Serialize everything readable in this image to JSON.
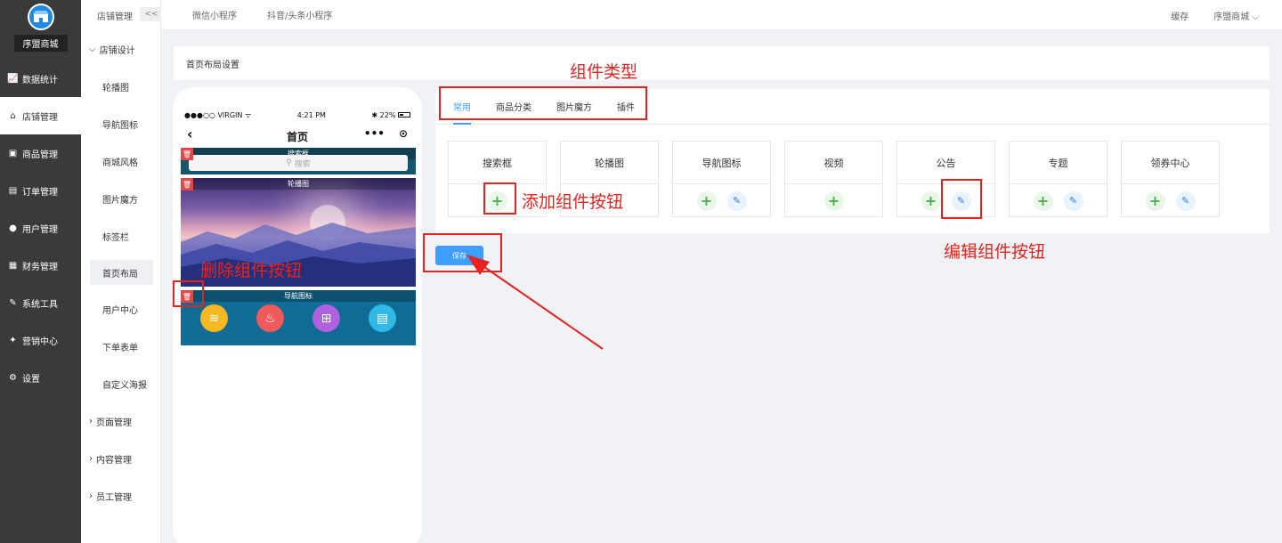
{
  "app": {
    "shop_name": "序盟商城"
  },
  "main_nav": [
    {
      "label": "数据统计",
      "icon": "chart-icon"
    },
    {
      "label": "店铺管理",
      "icon": "store-icon",
      "active": true
    },
    {
      "label": "商品管理",
      "icon": "goods-icon"
    },
    {
      "label": "订单管理",
      "icon": "order-icon"
    },
    {
      "label": "用户管理",
      "icon": "user-icon"
    },
    {
      "label": "财务管理",
      "icon": "finance-icon"
    },
    {
      "label": "系统工具",
      "icon": "wrench-icon"
    },
    {
      "label": "营销中心",
      "icon": "marketing-icon"
    },
    {
      "label": "设置",
      "icon": "gear-icon"
    }
  ],
  "sub_nav": {
    "header": "店铺管理",
    "collapse_label": "<<",
    "group_open": "店铺设计",
    "items": [
      "轮播图",
      "导航图标",
      "商城风格",
      "图片魔方",
      "标签栏",
      "首页布局",
      "用户中心",
      "下单表单",
      "自定义海报"
    ],
    "groups_closed": [
      "页面管理",
      "内容管理",
      "员工管理"
    ]
  },
  "topbar": {
    "links": [
      "微信小程序",
      "抖音/头条小程序"
    ],
    "cache": "缓存",
    "user": "序盟商城"
  },
  "page_title": "首页布局设置",
  "phone": {
    "carrier": "●●●○○ VIRGIN",
    "time": "4:21 PM",
    "battery": "22%",
    "title": "首页",
    "blocks": {
      "search_label": "搜索框",
      "search_placeholder": "搜索",
      "banner_label": "轮播图",
      "nav_label": "导航图标"
    },
    "nav_icon_colors": [
      "#f5b821",
      "#ef5b5b",
      "#b061e0",
      "#2fb9e6"
    ]
  },
  "tabs": [
    {
      "label": "常用",
      "active": true
    },
    {
      "label": "商品分类"
    },
    {
      "label": "图片魔方"
    },
    {
      "label": "插件"
    }
  ],
  "components": [
    {
      "title": "搜索框",
      "edit": false
    },
    {
      "title": "轮播图",
      "edit": false,
      "add": false
    },
    {
      "title": "导航图标",
      "edit": true
    },
    {
      "title": "视频",
      "edit": false
    },
    {
      "title": "公告",
      "edit": true
    },
    {
      "title": "专题",
      "edit": true
    },
    {
      "title": "领券中心",
      "edit": true
    }
  ],
  "save_label": "保存",
  "annotations": {
    "component_types": "组件类型",
    "add_button": "添加组件按钮",
    "delete_button": "删除组件按钮",
    "edit_button": "编辑组件按钮",
    "color": "#e8231f"
  }
}
